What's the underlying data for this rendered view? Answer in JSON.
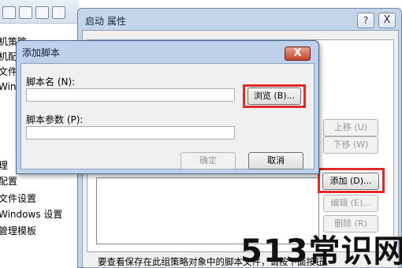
{
  "tree": {
    "items": [
      "机策略",
      "机配",
      "文件",
      "Win",
      "",
      "",
      "",
      "理",
      "配置",
      "文件设置",
      "Windows 设置",
      "管理模板"
    ]
  },
  "properties_window": {
    "title": "启动 属性",
    "help_label": "?",
    "close_label": "X",
    "buttons": {
      "move_up": "上移 (U)",
      "move_down": "下移 (W)",
      "add": "添加 (D)...",
      "edit": "编辑 (E)...",
      "remove": "删除 (R)"
    },
    "footer_text": "要查看保存在此组策略对象中的脚本文件，请按下面按钮。"
  },
  "add_script_dialog": {
    "title": "添加脚本",
    "close_label": "X",
    "script_name_label": "脚本名 (N):",
    "script_name_value": "",
    "browse_button": "浏览 (B)...",
    "script_params_label": "脚本参数 (P):",
    "script_params_value": "",
    "ok_button": "确定",
    "cancel_button": "取消"
  },
  "watermark": "513常识网",
  "colors": {
    "highlight": "#e02a2a",
    "window_frame": "#c4d5ea",
    "dialog_frame": "#bdd1ea"
  }
}
